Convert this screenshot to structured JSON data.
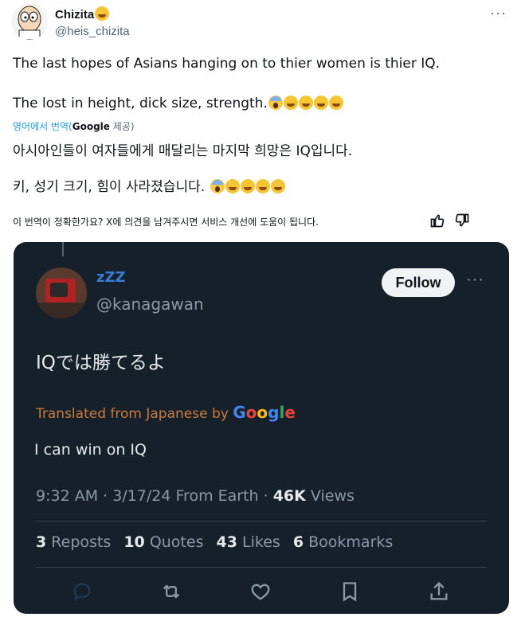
{
  "outer_tweet": {
    "name": "Chizita",
    "name_emoji": "face-with-tongue",
    "handle": "@heis_chizita",
    "more": "···",
    "line1": "The last hopes of Asians hanging on to thier women is thier IQ.",
    "line2": "The lost in height, dick size, strength.",
    "translate_prefix": "영어에서 번역(",
    "translate_google": "Google",
    "translate_suffix": " 제공)",
    "ko_line1": "아시아인들이 여자들에게 매달리는 마지막 희망은 IQ입니다.",
    "ko_line2": "키, 성기 크기, 힘이 사라졌습니다.",
    "feedback": "이 번역이 정확한가요? X에 의견을 남겨주시면 서비스 개선에 도움이 됩니다."
  },
  "quoted_tweet": {
    "zzz": "zZZ",
    "handle": "@kanagawan",
    "follow_label": "Follow",
    "more": "···",
    "original_text": "IQでは勝てるよ",
    "translated_label": "Translated from Japanese by ",
    "translated_brand": "Google",
    "translated_text": "I can win on IQ",
    "time": "9:32 AM · 3/17/24 From Earth · ",
    "views_num": "46K",
    "views_label": " Views",
    "stats": {
      "reposts_num": "3",
      "reposts_label": "Reposts",
      "quotes_num": "10",
      "quotes_label": "Quotes",
      "likes_num": "43",
      "likes_label": "Likes",
      "bookmarks_num": "6",
      "bookmarks_label": "Bookmarks"
    }
  },
  "icons": [
    "reply-icon",
    "repost-icon",
    "like-icon",
    "bookmark-icon",
    "share-icon",
    "thumbs-up-icon",
    "thumbs-down-icon"
  ],
  "colors": {
    "card_bg": "#15202b",
    "link": "#1d9bf0",
    "translated_label": "#c97b3a",
    "muted": "#8b98a5"
  }
}
